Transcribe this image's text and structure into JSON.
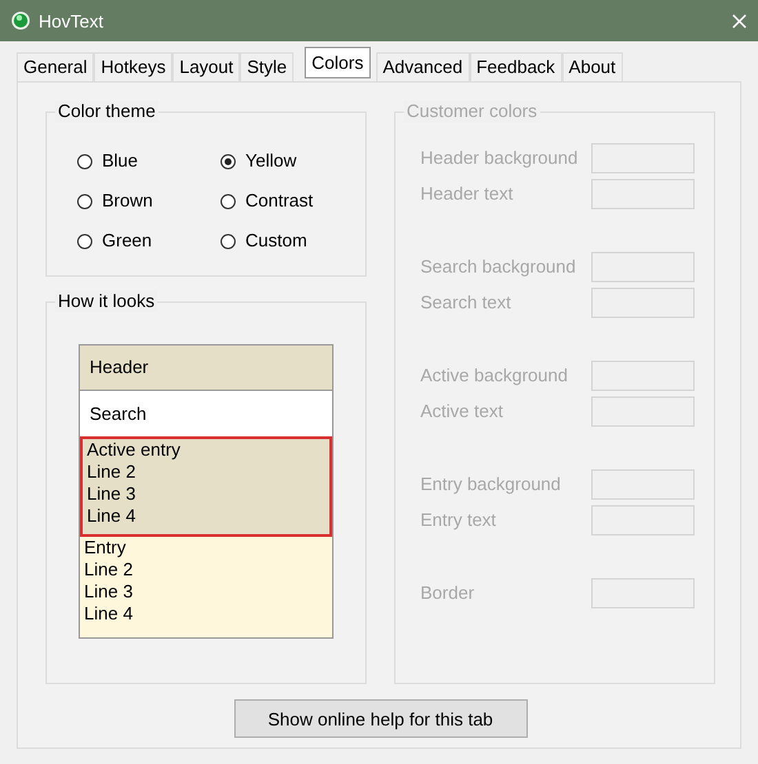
{
  "window": {
    "title": "HovText"
  },
  "tabs": [
    {
      "label": "General",
      "selected": false
    },
    {
      "label": "Hotkeys",
      "selected": false
    },
    {
      "label": "Layout",
      "selected": false
    },
    {
      "label": "Style",
      "selected": false
    },
    {
      "label": "Colors",
      "selected": true
    },
    {
      "label": "Advanced",
      "selected": false
    },
    {
      "label": "Feedback",
      "selected": false
    },
    {
      "label": "About",
      "selected": false
    }
  ],
  "color_theme": {
    "title": "Color theme",
    "options": [
      {
        "label": "Blue",
        "selected": false
      },
      {
        "label": "Yellow",
        "selected": true
      },
      {
        "label": "Brown",
        "selected": false
      },
      {
        "label": "Contrast",
        "selected": false
      },
      {
        "label": "Green",
        "selected": false
      },
      {
        "label": "Custom",
        "selected": false
      }
    ]
  },
  "preview": {
    "title": "How it looks",
    "sections": [
      {
        "kind": "header",
        "lines": [
          "Header"
        ]
      },
      {
        "kind": "search",
        "lines": [
          "Search"
        ]
      },
      {
        "kind": "active",
        "lines": [
          "Active entry",
          "Line 2",
          "Line 3",
          "Line 4"
        ]
      },
      {
        "kind": "entry",
        "lines": [
          "Entry",
          "Line 2",
          "Line 3",
          "Line 4"
        ]
      }
    ]
  },
  "customer_colors": {
    "title": "Customer colors",
    "disabled": true,
    "groups": [
      [
        {
          "label": "Header background"
        },
        {
          "label": "Header text"
        }
      ],
      [
        {
          "label": "Search background"
        },
        {
          "label": "Search text"
        }
      ],
      [
        {
          "label": "Active background"
        },
        {
          "label": "Active text"
        }
      ],
      [
        {
          "label": "Entry background"
        },
        {
          "label": "Entry text"
        }
      ],
      [
        {
          "label": "Border"
        }
      ]
    ]
  },
  "help_button": {
    "label": "Show online help for this tab"
  }
}
